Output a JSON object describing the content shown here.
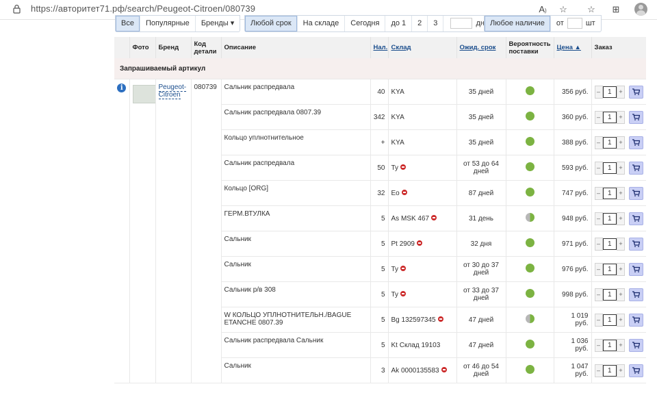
{
  "browser": {
    "url": "https://авторитет71.рф/search/Peugeot-Citroen/080739"
  },
  "filters": {
    "group1": [
      "Все",
      "Популярные",
      "Бренды ▾"
    ],
    "group2": [
      "Любой срок",
      "На складе",
      "Сегодня",
      "до 1",
      "2",
      "3"
    ],
    "days_suffix": "дн",
    "group3_label": "Любое наличие",
    "from_label": "от",
    "pcs_suffix": "шт"
  },
  "table": {
    "headers": {
      "photo": "Фото",
      "brand": "Бренд",
      "code": "Код детали",
      "description": "Описание",
      "qty": "Нал.",
      "warehouse": "Склад",
      "expected": "Ожид. срок",
      "probability": "Вероятность поставки",
      "price": "Цена ▲",
      "order": "Заказ"
    },
    "group_title": "Запрашиваемый артикул",
    "brand": "Peugeot-Citroen",
    "code": "080739",
    "order_qty": "1",
    "rows": [
      {
        "desc": "Сальник распредвала",
        "qty": "40",
        "wh": "KYA",
        "stop": false,
        "eta": "35 дней",
        "prob": "full",
        "price": "356 руб."
      },
      {
        "desc": "Сальник распредвала 0807.39",
        "qty": "342",
        "wh": "KYA",
        "stop": false,
        "eta": "35 дней",
        "prob": "full",
        "price": "360 руб."
      },
      {
        "desc": "Кольцо уплнотнительное",
        "qty": "+",
        "wh": "KYA",
        "stop": false,
        "eta": "35 дней",
        "prob": "full",
        "price": "388 руб."
      },
      {
        "desc": "Сальник распредвала",
        "qty": "50",
        "wh": "Ty",
        "stop": true,
        "eta": "от 53 до 64 дней",
        "prob": "full",
        "price": "593 руб."
      },
      {
        "desc": "Кольцо [ORG]",
        "qty": "32",
        "wh": "Eo",
        "stop": true,
        "eta": "87 дней",
        "prob": "full",
        "price": "747 руб."
      },
      {
        "desc": "ГЕРМ.ВТУЛКА",
        "qty": "5",
        "wh": "As MSK 467",
        "stop": true,
        "eta": "31 день",
        "prob": "half",
        "price": "948 руб."
      },
      {
        "desc": "Сальник",
        "qty": "5",
        "wh": "Pt 2909",
        "stop": true,
        "eta": "32 дня",
        "prob": "full",
        "price": "971 руб."
      },
      {
        "desc": "Сальник",
        "qty": "5",
        "wh": "Ty",
        "stop": true,
        "eta": "от 30 до 37 дней",
        "prob": "full",
        "price": "976 руб."
      },
      {
        "desc": "Сальник р/в 308",
        "qty": "5",
        "wh": "Ty",
        "stop": true,
        "eta": "от 33 до 37 дней",
        "prob": "full",
        "price": "998 руб."
      },
      {
        "desc": "W КОЛЬЦО УПЛНОТНИТЕЛЬН./BAGUE ETANCHE 0807.39",
        "qty": "5",
        "wh": "Bg 132597345",
        "stop": true,
        "eta": "47 дней",
        "prob": "half",
        "price": "1 019 руб."
      },
      {
        "desc": "Сальник распредвала Сальник",
        "qty": "5",
        "wh": "Kt Склад 19103",
        "stop": false,
        "eta": "47 дней",
        "prob": "full",
        "price": "1 036 руб."
      },
      {
        "desc": "Сальник",
        "qty": "3",
        "wh": "Ak 0000135583",
        "stop": true,
        "eta": "от 46 до 54 дней",
        "prob": "full",
        "price": "1 047 руб."
      }
    ]
  }
}
